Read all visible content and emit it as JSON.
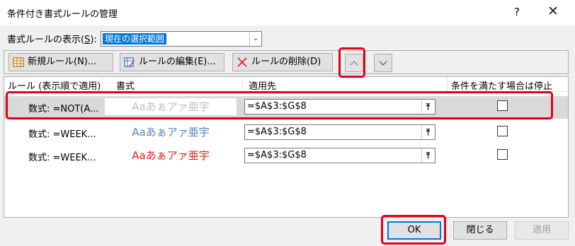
{
  "window": {
    "title": "条件付き書式ルールの管理",
    "help": "?",
    "close": "✕"
  },
  "show_rules": {
    "label_prefix": "書式ルールの表示(",
    "label_key": "S",
    "label_suffix": "):",
    "value": "現在の選択範囲"
  },
  "toolbar": {
    "new_rule": "新規ルール(N)...",
    "edit_rule": "ルールの編集(E)...",
    "delete_rule": "ルールの削除(D)"
  },
  "headers": {
    "rule": "ルール (表示順で適用)",
    "format": "書式",
    "applies_to": "適用先",
    "stop_if_true": "条件を満たす場合は停止"
  },
  "rules": [
    {
      "condition": "数式: =NOT(A...",
      "preview": "Aaあぁアァ亜宇",
      "preview_color": "#bfbfbf",
      "applies_to": "=$A$3:$G$8",
      "stop_if_true": false,
      "selected": true
    },
    {
      "condition": "数式: =WEEK...",
      "preview": "Aaあぁアァ亜宇",
      "preview_color": "#4f81bd",
      "applies_to": "=$A$3:$G$8",
      "stop_if_true": false,
      "selected": false
    },
    {
      "condition": "数式: =WEEK...",
      "preview": "Aaあぁアァ亜宇",
      "preview_color": "#e02020",
      "applies_to": "=$A$3:$G$8",
      "stop_if_true": false,
      "selected": false
    }
  ],
  "buttons": {
    "ok": "OK",
    "close": "閉じる",
    "apply": "適用"
  },
  "colors": {
    "highlight": "#e0001a",
    "accent": "#0078d7"
  }
}
